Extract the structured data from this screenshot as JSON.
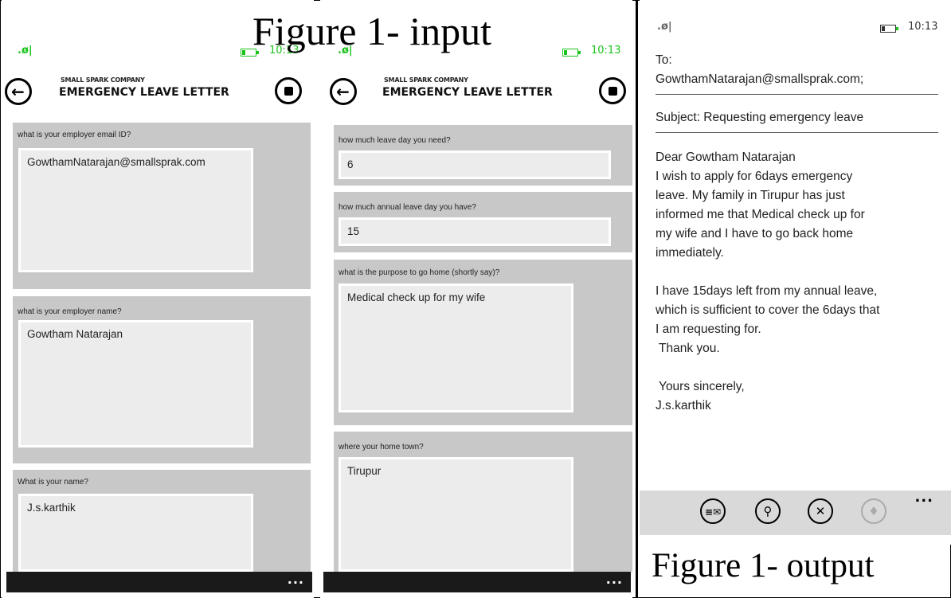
{
  "captions": {
    "input": "Figure 1- input",
    "output": "Figure 1- output"
  },
  "status": {
    "signal_icon": "signal-icon",
    "battery_icon": "battery-icon",
    "time_left": "10:13",
    "time_middle": "10:13",
    "time_right": "10:13"
  },
  "app": {
    "company": "SMALL SPARK COMPANY",
    "title": "EMERGENCY LEAVE LETTER",
    "back_icon": "back-arrow-icon",
    "stop_icon": "stop-icon",
    "more": "..."
  },
  "form_left": [
    {
      "label": "what is your employer email ID?",
      "value": "GowthamNatarajan@smallsprak.com"
    },
    {
      "label": "what is your employer name?",
      "value": "Gowtham Natarajan"
    },
    {
      "label": "What is your name?",
      "value": "J.s.karthik"
    }
  ],
  "form_right": [
    {
      "label": "how much leave day you need?",
      "value": "6"
    },
    {
      "label": "how much annual leave day you have?",
      "value": "15"
    },
    {
      "label": "what is the purpose to go home (shortly say)?",
      "value": "Medical check up for my wife"
    },
    {
      "label": "where your home town?",
      "value": "Tirupur"
    }
  ],
  "email": {
    "to_label": "To:",
    "to_value": "GowthamNatarajan@smallsprak.com;",
    "subject": "Subject:  Requesting emergency leave",
    "body_lines": [
      "Dear Gowtham Natarajan",
      "I wish to apply for 6days emergency",
      "leave. My family in Tirupur has just",
      "informed me that Medical check up for",
      "my wife and I have to go back home",
      "immediately.",
      "",
      "I have 15days left from my annual leave,",
      "which is sufficient to cover the 6days that",
      "I am requesting for.",
      " Thank you.",
      "",
      " Yours sincerely,",
      "J.s.karthik"
    ],
    "commands": [
      {
        "name": "send-icon",
        "glyph": "≡✉"
      },
      {
        "name": "attach-icon",
        "glyph": "⚲"
      },
      {
        "name": "delete-icon",
        "glyph": "✕"
      },
      {
        "name": "microphone-icon",
        "glyph": "♦"
      }
    ],
    "more": "..."
  }
}
